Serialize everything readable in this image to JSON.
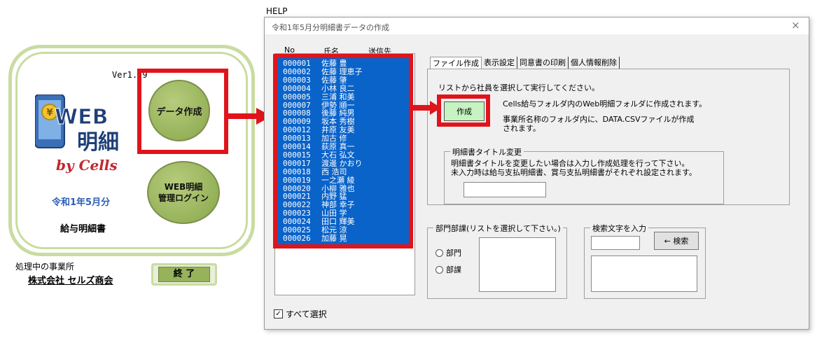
{
  "launcher": {
    "version": "Ver1.  9",
    "logo_web": "WEB",
    "logo_meisai": "明細",
    "logo_by": "by Cells",
    "period": "令和1年5月分",
    "payslip": "給与明細書",
    "create_button": "データ作成",
    "login_button_line1": "WEB明細",
    "login_button_line2": "管理ログイン",
    "office_label": "処理中の事業所",
    "office_name": "株式会社 セルズ商会",
    "end_button": "終 了"
  },
  "help_label": "HELP",
  "dialog": {
    "title": "令和1年5月分明細書データの作成",
    "close": "×",
    "list_headers": {
      "no": "No",
      "name": "氏名",
      "sent": "送信先"
    },
    "employees": [
      {
        "no": "000001",
        "name": "佐藤 豊"
      },
      {
        "no": "000002",
        "name": "佐藤 理恵子"
      },
      {
        "no": "000003",
        "name": "佐藤 肇"
      },
      {
        "no": "000004",
        "name": "小林 良二"
      },
      {
        "no": "000005",
        "name": "三浦 和美"
      },
      {
        "no": "000007",
        "name": "伊勢 順一"
      },
      {
        "no": "000008",
        "name": "後藤 純男"
      },
      {
        "no": "000009",
        "name": "坂本 秀樹"
      },
      {
        "no": "000012",
        "name": "井原 友美"
      },
      {
        "no": "000013",
        "name": "加古 修"
      },
      {
        "no": "000014",
        "name": "荻原 真一"
      },
      {
        "no": "000015",
        "name": "大石 弘文"
      },
      {
        "no": "000017",
        "name": "渡邊 かおり"
      },
      {
        "no": "000018",
        "name": "西 浩司"
      },
      {
        "no": "000019",
        "name": "一之瀬 綾"
      },
      {
        "no": "000020",
        "name": "小柳 雅也"
      },
      {
        "no": "000021",
        "name": "内野 猛"
      },
      {
        "no": "000022",
        "name": "神部 幸子"
      },
      {
        "no": "000023",
        "name": "山田 学"
      },
      {
        "no": "000024",
        "name": "田口 輝美"
      },
      {
        "no": "000025",
        "name": "松元 涼"
      },
      {
        "no": "000026",
        "name": "加藤 晃"
      }
    ],
    "select_all": "すべて選択",
    "tabs": [
      "ファイル作成",
      "表示設定",
      "同意書の印刷",
      "個人情報削除"
    ],
    "instruction": "リストから社員を選択して実行してください。",
    "make_button": "作成",
    "info_line1": "Cells給与フォルダ内のWeb明細フォルダに作成されます。",
    "info_line2": "事業所名称のフォルダ内に、DATA.CSVファイルが作成されます。",
    "title_group": "明細書タイトル変更",
    "title_msg1": "明細書タイトルを変更したい場合は入力し作成処理を行って下さい。",
    "title_msg2": "未入力時は給与支払明細書、賞与支払明細書がそれぞれ設定されます。",
    "dept_group": "部門部課(リストを選択して下さい。)",
    "radio_dept": "部門",
    "radio_section": "部課",
    "search_group": "検索文字を入力",
    "search_button": "← 検索"
  }
}
